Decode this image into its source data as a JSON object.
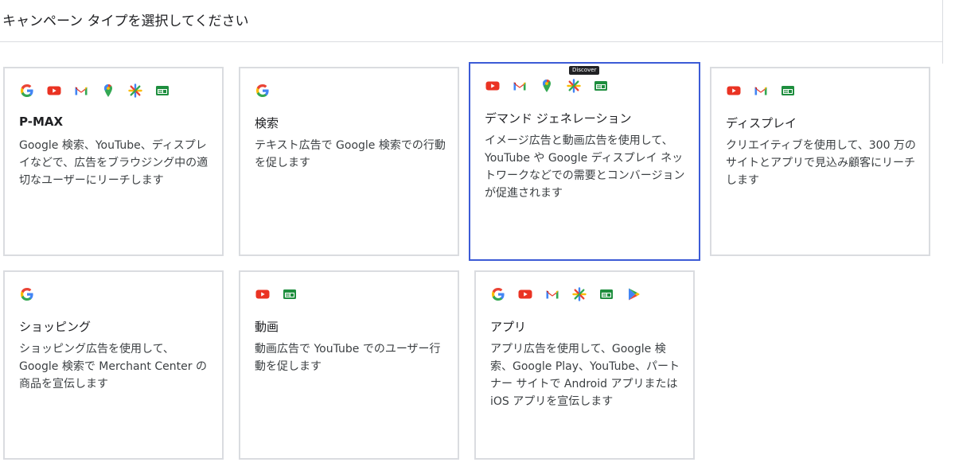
{
  "header": {
    "title": "キャンペーン タイプを選択してください"
  },
  "tooltip": {
    "text": "Discover"
  },
  "colors": {
    "selected_border": "#3c5bd6",
    "card_border": "#dadce0"
  },
  "cards": [
    {
      "id": "pmax",
      "title": "P-MAX",
      "description": "Google 検索、YouTube、ディスプレイなどで、広告をブラウジング中の適切なユーザーにリーチします",
      "icons": [
        "google-icon",
        "youtube-icon",
        "gmail-icon",
        "maps-icon",
        "discover-icon",
        "display-icon"
      ],
      "selected": false
    },
    {
      "id": "search",
      "title": "検索",
      "description": "テキスト広告で Google 検索での行動を促します",
      "icons": [
        "google-icon"
      ],
      "selected": false
    },
    {
      "id": "demand-gen",
      "title": "デマンド ジェネレーション",
      "description": "イメージ広告と動画広告を使用して、YouTube や Google ディスプレイ ネットワークなどでの需要とコンバージョンが促進されます",
      "icons": [
        "youtube-icon",
        "gmail-icon",
        "maps-icon",
        "discover-icon",
        "display-icon"
      ],
      "selected": true
    },
    {
      "id": "display",
      "title": "ディスプレイ",
      "description": "クリエイティブを使用して、300 万のサイトとアプリで見込み顧客にリーチします",
      "icons": [
        "youtube-icon",
        "gmail-icon",
        "display-icon"
      ],
      "selected": false
    },
    {
      "id": "shopping",
      "title": "ショッピング",
      "description": "ショッピング広告を使用して、Google 検索で Merchant Center の商品を宣伝します",
      "icons": [
        "google-icon"
      ],
      "selected": false
    },
    {
      "id": "video",
      "title": "動画",
      "description": "動画広告で YouTube でのユーザー行動を促します",
      "icons": [
        "youtube-icon",
        "display-icon"
      ],
      "selected": false
    },
    {
      "id": "app",
      "title": "アプリ",
      "description": "アプリ広告を使用して、Google 検索、Google Play、YouTube、パートナー サイトで Android アプリまたは iOS アプリを宣伝します",
      "icons": [
        "google-icon",
        "youtube-icon",
        "gmail-icon",
        "discover-icon",
        "display-icon",
        "play-icon"
      ],
      "selected": false
    }
  ]
}
